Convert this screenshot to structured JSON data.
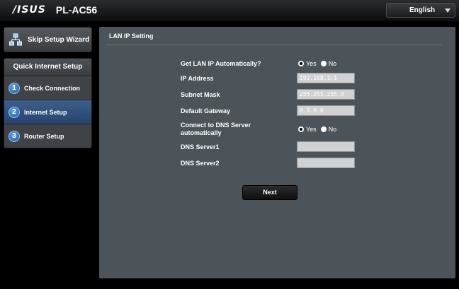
{
  "header": {
    "brand": "/ISUS",
    "model": "PL-AC56",
    "language": "English",
    "language_icon": "chevron-down-icon"
  },
  "sidebar": {
    "skip_label": "Skip Setup Wizard",
    "skip_icon": "network-icon",
    "qis_title": "Quick Internet Setup",
    "steps": [
      {
        "num": "1",
        "label": "Check Connection",
        "active": false
      },
      {
        "num": "2",
        "label": "Internet Setup",
        "active": true
      },
      {
        "num": "3",
        "label": "Router Setup",
        "active": false
      }
    ]
  },
  "main": {
    "title": "LAN IP Setting",
    "auto_ip": {
      "label": "Get LAN IP Automatically?",
      "yes": "Yes",
      "no": "No",
      "selected": "Yes"
    },
    "ip_address": {
      "label": "IP Address",
      "value": "192.168.1.1"
    },
    "subnet_mask": {
      "label": "Subnet Mask",
      "value": "255.255.255.0"
    },
    "default_gateway": {
      "label": "Default Gateway",
      "value": "0.0.0.0"
    },
    "dns_auto": {
      "label_line1": "Connect to DNS Server",
      "label_line2": "automatically",
      "yes": "Yes",
      "no": "No",
      "selected": "Yes"
    },
    "dns1": {
      "label": "DNS Server1",
      "value": ""
    },
    "dns2": {
      "label": "DNS Server2",
      "value": ""
    },
    "next_label": "Next"
  },
  "colors": {
    "panel": "#4d5459",
    "active_step": "#2f5382",
    "field": "#cfd1d3"
  }
}
